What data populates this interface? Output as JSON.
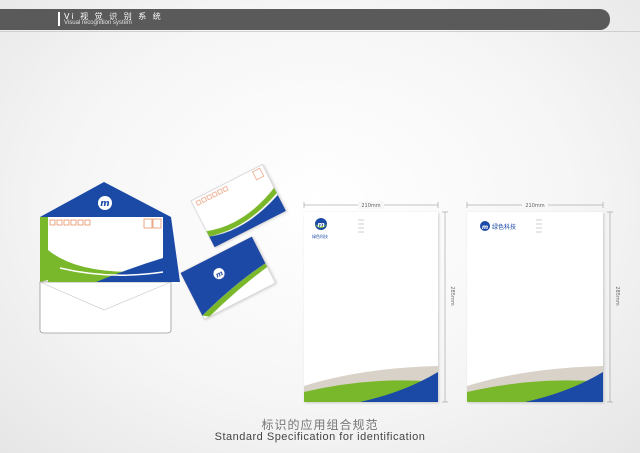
{
  "header": {
    "title": "Vi 视 觉 识 别 系 统",
    "subtitle": "Visual recognition system"
  },
  "logo": {
    "mark": "m",
    "company_name": "绿色科技"
  },
  "dimensions": {
    "letterhead_width": "210mm",
    "letterhead_height": "285mm"
  },
  "caption": {
    "chinese": "标识的应用组合规范",
    "english": "Standard Specification for identification"
  },
  "colors": {
    "brand_blue": "#1b4aa6",
    "brand_green": "#7ab82b",
    "accent_orange": "#e0703a",
    "swoosh_gray": "#c9bfb2"
  }
}
